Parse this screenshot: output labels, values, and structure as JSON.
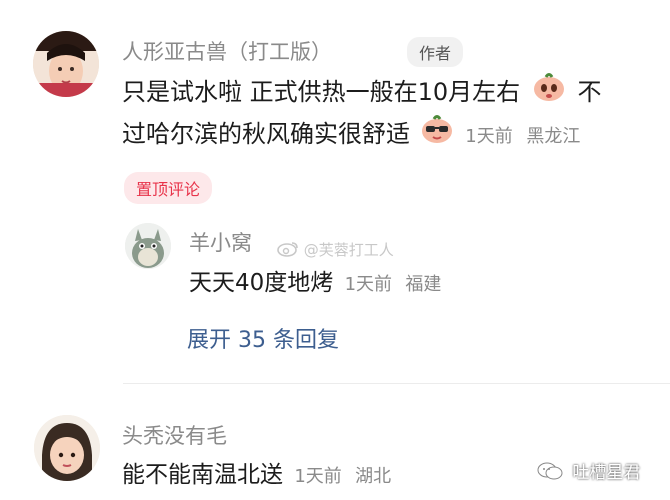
{
  "comments": [
    {
      "username": "人形亚古兽（打工版）",
      "author_badge": "作者",
      "line1": "只是试水啦 正式供热一般在10月左右",
      "line1_tail": "不",
      "line2": "过哈尔滨的秋风确实很舒适",
      "time": "1天前",
      "location": "黑龙江",
      "pin_label": "置顶评论",
      "emoji": "peach-emoji"
    },
    {
      "username": "羊小窝",
      "content": "天天40度地烤",
      "time": "1天前",
      "location": "福建",
      "expand_label": "展开 35 条回复"
    },
    {
      "username": "头秃没有毛",
      "content": "能不能南温北送",
      "time": "1天前",
      "location": "湖北"
    }
  ],
  "watermarks": {
    "center": "@芙蓉打工人",
    "corner": "吐槽星君"
  },
  "colors": {
    "username": "#8a8a8a",
    "content": "#1c1c1c",
    "pin_bg": "#fde8ea",
    "pin_text": "#e8334a",
    "expand_link": "#3d5e8f"
  }
}
